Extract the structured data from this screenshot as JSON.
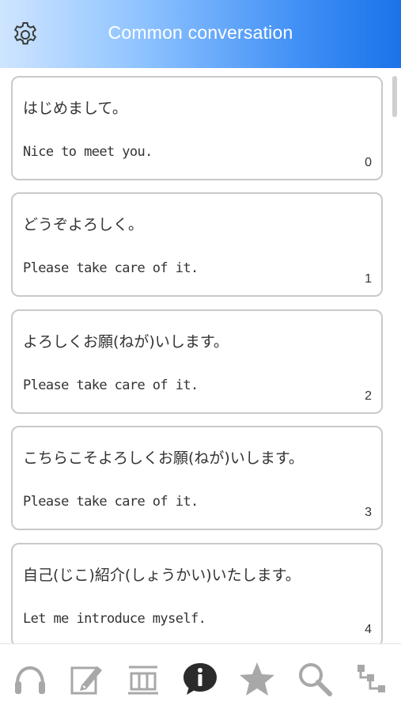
{
  "header": {
    "title": "Common conversation"
  },
  "items": [
    {
      "jp": "はじめまして。",
      "en": "Nice to meet you.",
      "num": "0"
    },
    {
      "jp": "どうぞよろしく。",
      "en": "Please take care of it.",
      "num": "1"
    },
    {
      "jp": "よろしくお願(ねが)いします。",
      "en": "Please take care of it.",
      "num": "2"
    },
    {
      "jp": "こちらこそよろしくお願(ねが)いします。",
      "en": "Please take care of it.",
      "num": "3"
    },
    {
      "jp": "自己(じこ)紹介(しょうかい)いたします。",
      "en": "Let me introduce myself.",
      "num": "4"
    }
  ],
  "tabs": [
    {
      "icon": "headphones-icon"
    },
    {
      "icon": "edit-icon"
    },
    {
      "icon": "kanji-icon"
    },
    {
      "icon": "info-icon"
    },
    {
      "icon": "star-icon"
    },
    {
      "icon": "search-icon"
    },
    {
      "icon": "hierarchy-icon"
    }
  ],
  "colors": {
    "accent": "#1a73e8",
    "header_light": "#cfe5ff",
    "icon_gray": "#a8a8a8",
    "icon_active": "#2b2b2b"
  }
}
